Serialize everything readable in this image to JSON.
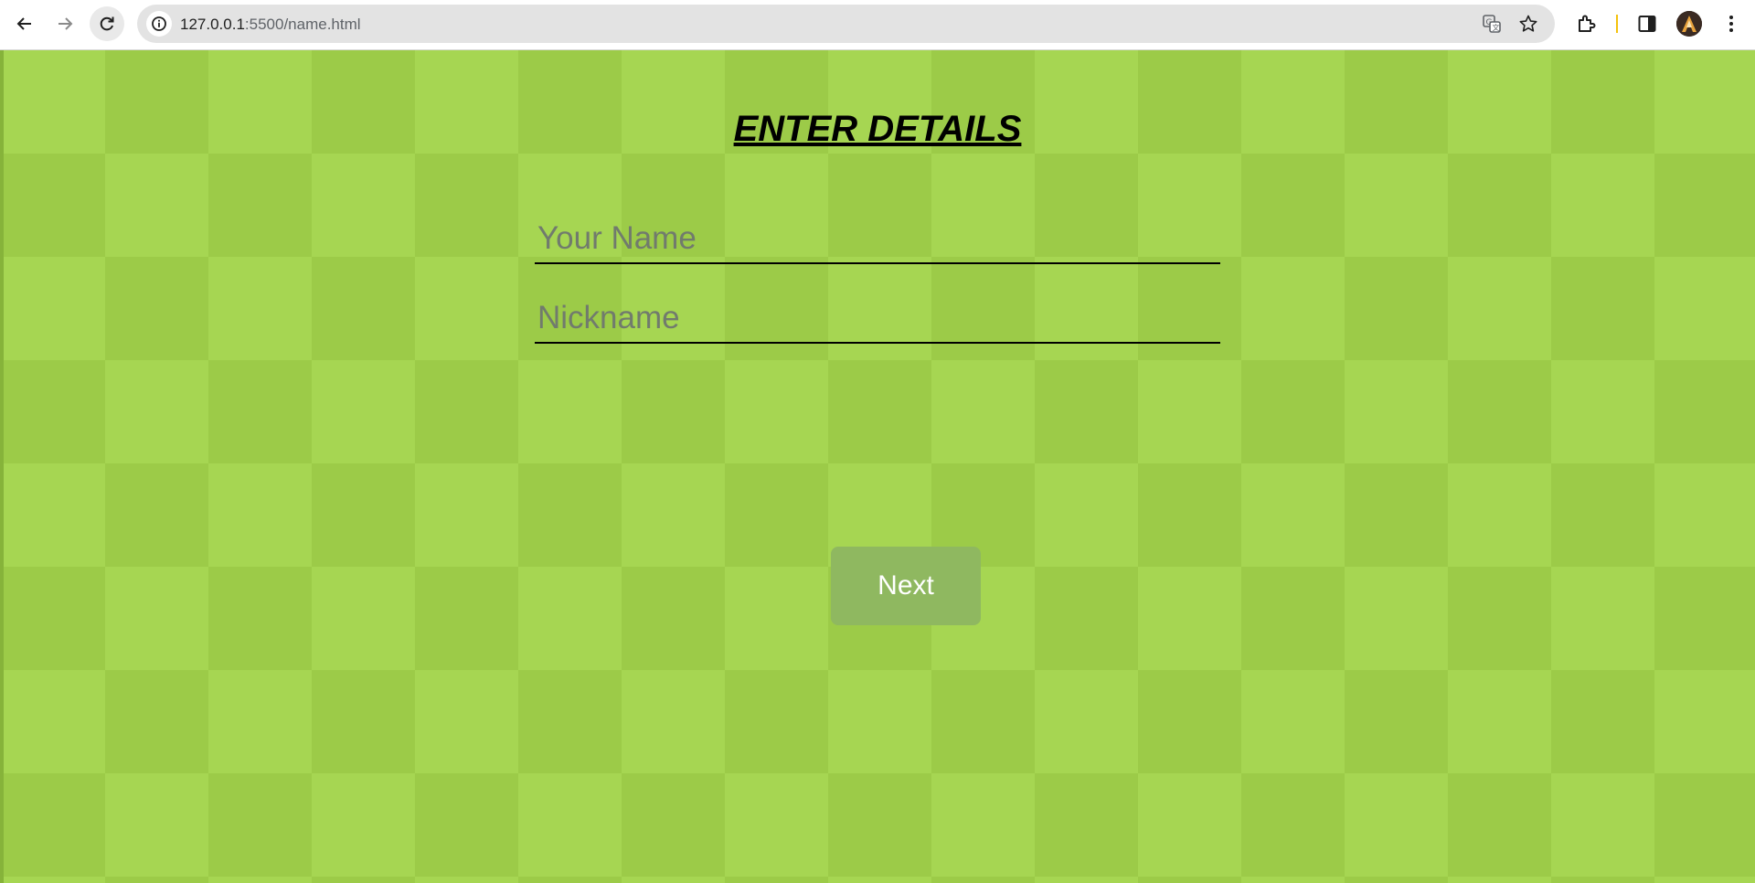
{
  "browser": {
    "url_host": "127.0.0.1",
    "url_path": ":5500/name.html"
  },
  "form": {
    "title": "ENTER DETAILS",
    "name_placeholder": "Your Name",
    "nickname_placeholder": "Nickname",
    "next_label": "Next"
  },
  "colors": {
    "background": "#a6d652",
    "checker": "#9ccb48",
    "button": "#8fb860",
    "button_text": "#ffffff"
  },
  "icons": {
    "back": "back-arrow-icon",
    "forward": "forward-arrow-icon",
    "reload": "reload-icon",
    "info": "info-icon",
    "translate": "translate-icon",
    "bookmark": "star-icon",
    "extensions": "puzzle-icon",
    "side_panel": "side-panel-icon",
    "menu": "kebab-menu-icon"
  }
}
